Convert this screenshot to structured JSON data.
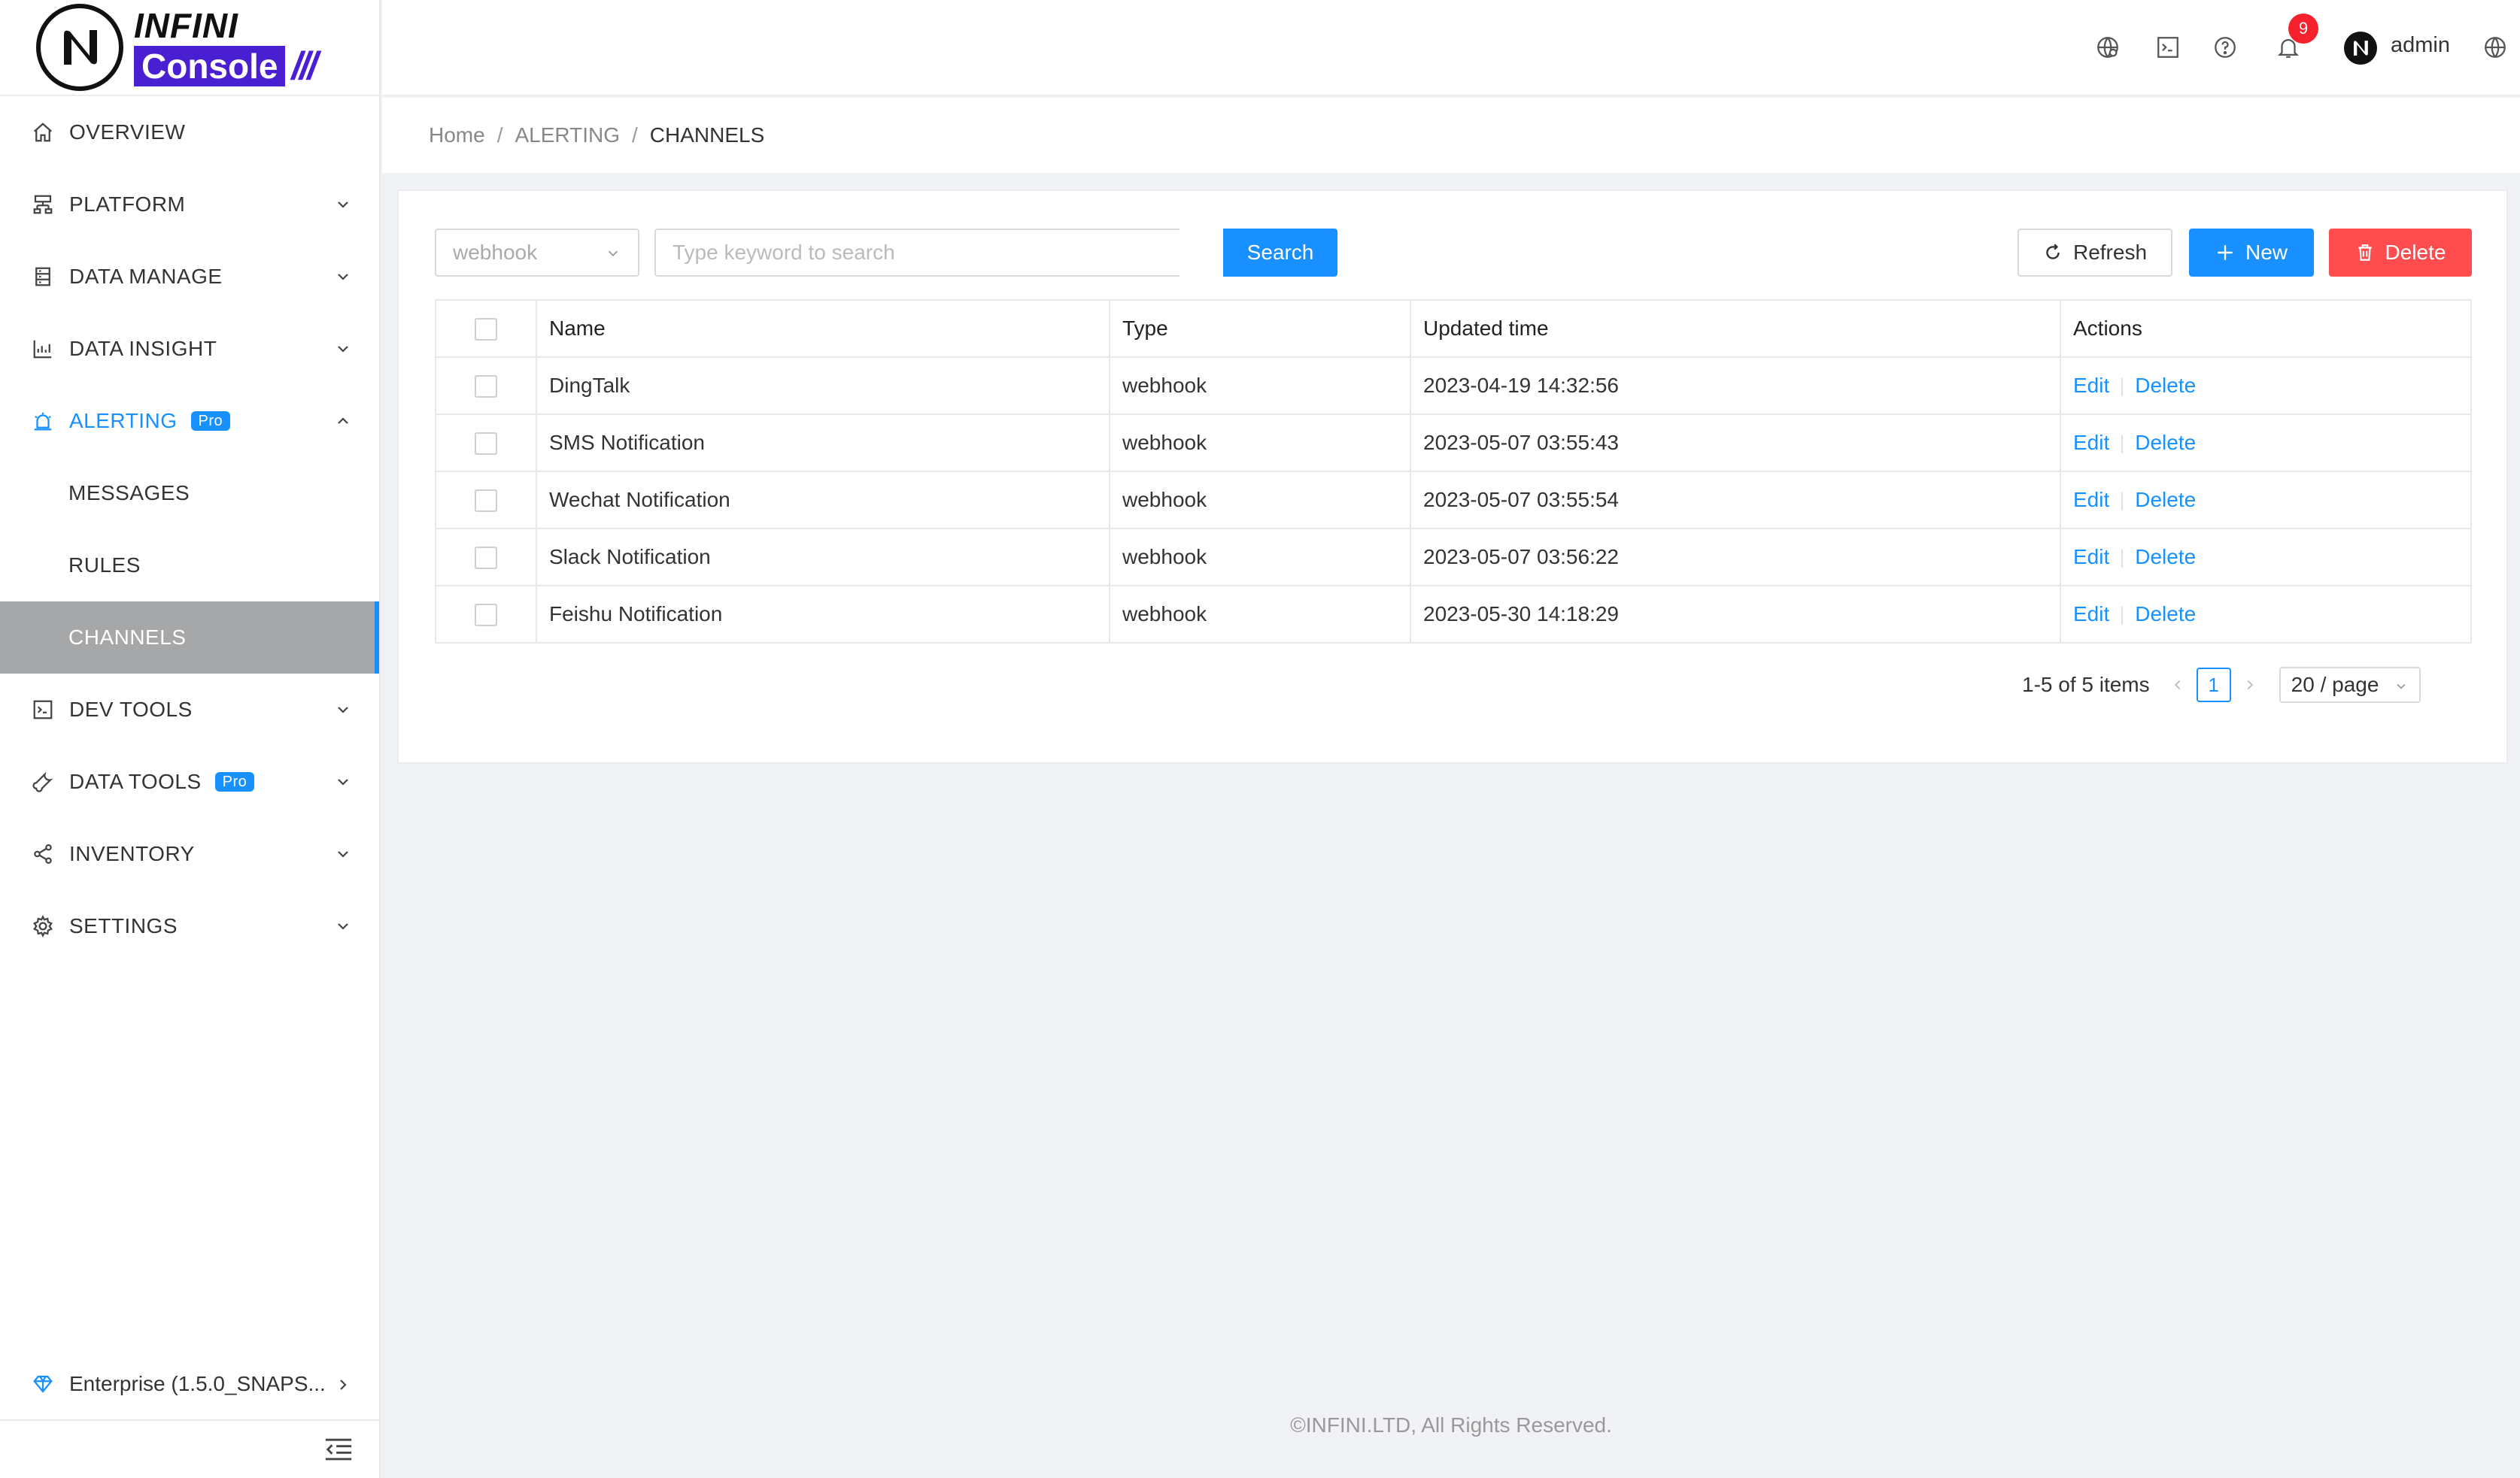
{
  "app": {
    "logo_top": "INFINI",
    "logo_bottom": "Console",
    "logo_slashes": "///"
  },
  "sidebar": {
    "items": [
      {
        "label": "OVERVIEW"
      },
      {
        "label": "PLATFORM"
      },
      {
        "label": "DATA MANAGE"
      },
      {
        "label": "DATA INSIGHT"
      },
      {
        "label": "ALERTING",
        "badge": "Pro"
      },
      {
        "label": "MESSAGES"
      },
      {
        "label": "RULES"
      },
      {
        "label": "CHANNELS"
      },
      {
        "label": "DEV TOOLS"
      },
      {
        "label": "DATA TOOLS",
        "badge": "Pro"
      },
      {
        "label": "INVENTORY"
      },
      {
        "label": "SETTINGS"
      }
    ],
    "enterprise_label": "Enterprise (1.5.0_SNAPS..."
  },
  "header": {
    "notification_count": "9",
    "username": "admin"
  },
  "breadcrumb": {
    "home": "Home",
    "section": "ALERTING",
    "current": "CHANNELS",
    "separator": "/"
  },
  "toolbar": {
    "type_filter": "webhook",
    "search_placeholder": "Type keyword to search",
    "search_label": "Search",
    "refresh_label": "Refresh",
    "new_label": "New",
    "delete_label": "Delete"
  },
  "table": {
    "columns": [
      "Name",
      "Type",
      "Updated time",
      "Actions"
    ],
    "rows": [
      {
        "name": "DingTalk",
        "type": "webhook",
        "updated": "2023-04-19 14:32:56"
      },
      {
        "name": "SMS Notification",
        "type": "webhook",
        "updated": "2023-05-07 03:55:43"
      },
      {
        "name": "Wechat Notification",
        "type": "webhook",
        "updated": "2023-05-07 03:55:54"
      },
      {
        "name": "Slack Notification",
        "type": "webhook",
        "updated": "2023-05-07 03:56:22"
      },
      {
        "name": "Feishu Notification",
        "type": "webhook",
        "updated": "2023-05-30 14:18:29"
      }
    ],
    "edit_label": "Edit",
    "delete_label": "Delete"
  },
  "pagination": {
    "summary": "1-5 of 5 items",
    "current_page": "1",
    "page_size": "20 / page"
  },
  "footer": {
    "copyright": "©INFINI.LTD, All Rights Reserved."
  },
  "colors": {
    "primary": "#1890ff",
    "danger": "#ff4d4f",
    "selected_bg": "#a6a7a8",
    "logo_purple": "#4a1fd1"
  }
}
